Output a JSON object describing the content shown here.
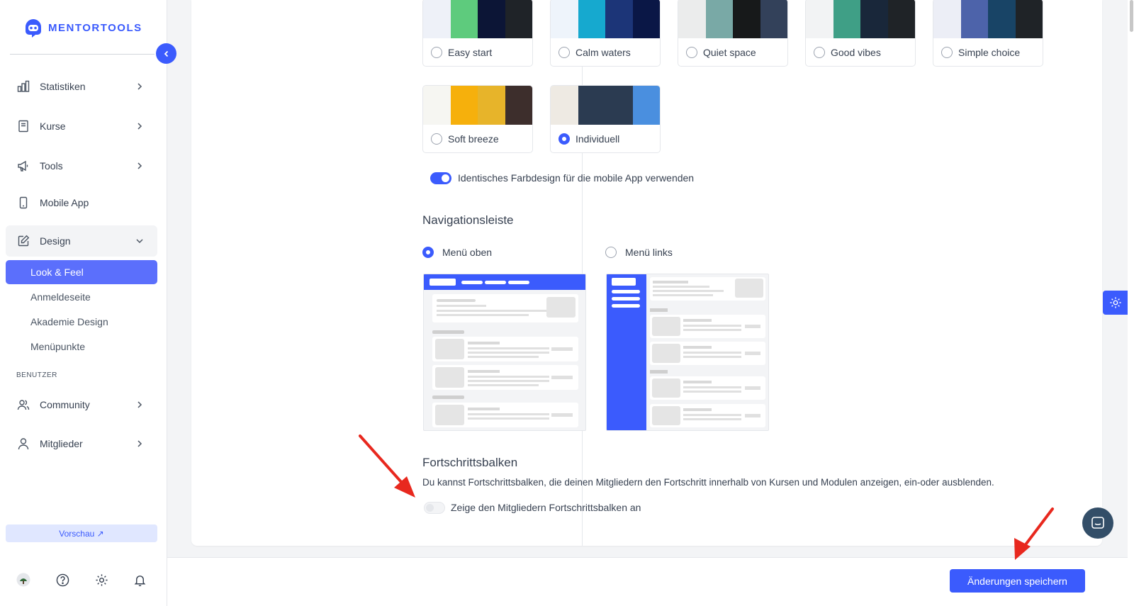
{
  "app": {
    "logo_text": "MENTORTOOLS"
  },
  "sidebar": {
    "items": [
      {
        "label": "Statistiken"
      },
      {
        "label": "Kurse"
      },
      {
        "label": "Tools"
      },
      {
        "label": "Mobile App"
      },
      {
        "label": "Design"
      }
    ],
    "sub_items": [
      {
        "label": "Look & Feel"
      },
      {
        "label": "Anmeldeseite"
      },
      {
        "label": "Akademie Design"
      },
      {
        "label": "Menüpunkte"
      }
    ],
    "section_users": "BENUTZER",
    "user_items": [
      {
        "label": "Community"
      },
      {
        "label": "Mitglieder"
      }
    ],
    "preview_label": "Vorschau ↗"
  },
  "palettes": [
    {
      "label": "Easy start",
      "colors": [
        "#eef1f8",
        "#5ecb7d",
        "#0c1536",
        "#1f2328"
      ],
      "selected": false
    },
    {
      "label": "Calm waters",
      "colors": [
        "#eef4fb",
        "#16a9cf",
        "#1c3578",
        "#0a1746"
      ],
      "selected": false
    },
    {
      "label": "Quiet space",
      "colors": [
        "#ebecec",
        "#79a9a6",
        "#17191a",
        "#33415a"
      ],
      "selected": false
    },
    {
      "label": "Good vibes",
      "colors": [
        "#f2f3f4",
        "#3f9f86",
        "#19273a",
        "#1f2327"
      ],
      "selected": false
    },
    {
      "label": "Simple choice",
      "colors": [
        "#eceef6",
        "#4d63aa",
        "#184466",
        "#1f2327"
      ],
      "selected": false
    },
    {
      "label": "Soft breeze",
      "colors": [
        "#f6f6f2",
        "#f6b00c",
        "#e7b42a",
        "#3d2e2c"
      ],
      "selected": false
    },
    {
      "label": "Individuell",
      "colors": [
        "#eeeae3",
        "#2b3b51",
        "#2b3b51",
        "#4a8fdf"
      ],
      "selected": true
    }
  ],
  "mobile_toggle_label": "Identisches Farbdesign für die mobile App verwenden",
  "nav_section": {
    "title": "Navigationsleiste",
    "option_top": "Menü oben",
    "option_left": "Menü links",
    "selected": "top"
  },
  "progress_section": {
    "title": "Fortschrittsbalken",
    "description": "Du kannst Fortschrittsbalken, die deinen Mitgliedern den Fortschritt innerhalb von Kursen und Modulen anzeigen, ein-oder ausblenden.",
    "toggle_label": "Zeige den Mitgliedern Fortschrittsbalken an",
    "toggle_on": false
  },
  "save_button": "Änderungen speichern",
  "colors": {
    "accent": "#3b5bfd",
    "annotation_arrow": "#e8281e"
  }
}
